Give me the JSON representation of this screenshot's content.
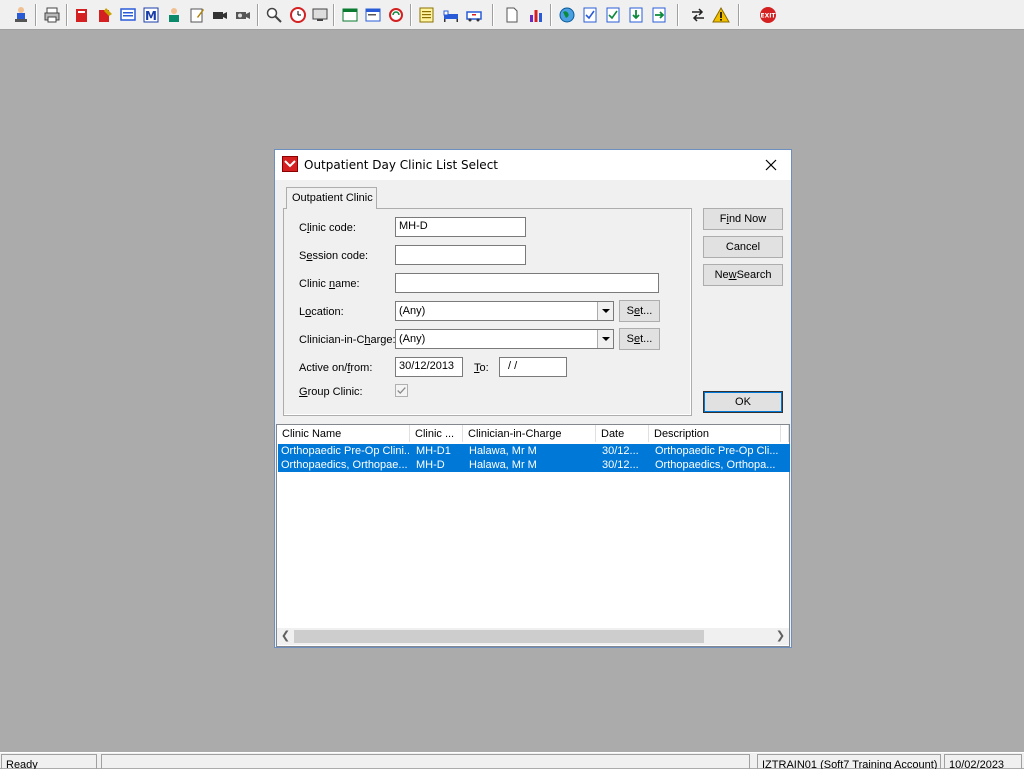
{
  "toolbar": {
    "buttons": [
      {
        "icon": "person-at-computer-icon",
        "color": "#2a5bd7"
      },
      {
        "icon": "printer-icon",
        "color": "#444444"
      },
      {
        "icon": "red-book-icon",
        "color": "#d42020"
      },
      {
        "icon": "book-edit-icon",
        "color": "#d42020"
      },
      {
        "icon": "screen-list-icon",
        "color": "#2a5bd7"
      },
      {
        "icon": "letter-m-icon",
        "color": "#1a3ea8"
      },
      {
        "icon": "doctor-icon",
        "color": "#0a8a6a"
      },
      {
        "icon": "notes-edit-icon",
        "color": "#b08000"
      },
      {
        "icon": "video-camera-icon",
        "color": "#333333"
      },
      {
        "icon": "video-camera-alt-icon",
        "color": "#333333"
      },
      {
        "icon": "magnify-icon",
        "color": "#444444"
      },
      {
        "icon": "clock-icon",
        "color": "#d42020"
      },
      {
        "icon": "monitor-icon",
        "color": "#444444"
      },
      {
        "icon": "window-panel-icon",
        "color": "#0a7a30"
      },
      {
        "icon": "window-list-icon",
        "color": "#2a5bd7"
      },
      {
        "icon": "globe-refresh-icon",
        "color": "#d42020"
      },
      {
        "icon": "yellow-notes-icon",
        "color": "#c8a000"
      },
      {
        "icon": "bed-icon",
        "color": "#2a5bd7"
      },
      {
        "icon": "ambulance-icon",
        "color": "#2a5bd7"
      },
      {
        "icon": "document-icon",
        "color": "#555555"
      },
      {
        "icon": "bar-chart-icon",
        "color": "#6a2ac0"
      },
      {
        "icon": "globe-icon",
        "color": "#0a8a3a"
      },
      {
        "icon": "form-check-icon",
        "color": "#2a5bd7"
      },
      {
        "icon": "form-tick-icon",
        "color": "#2a5bd7"
      },
      {
        "icon": "form-down-arrow-icon",
        "color": "#0a8a3a"
      },
      {
        "icon": "form-green-arrow-icon",
        "color": "#0a8a3a"
      },
      {
        "icon": "swap-arrows-icon",
        "color": "#222222"
      },
      {
        "icon": "warning-icon",
        "color": "#f0c000"
      },
      {
        "icon": "exit-icon",
        "color": "#d42020"
      }
    ]
  },
  "dialog": {
    "title": "Outpatient Day Clinic List Select",
    "tab_label": "Outpatient Clinic",
    "clinic_code_label_pre": "C",
    "clinic_code_label_ul": "l",
    "clinic_code_label_post": "inic code:",
    "clinic_code_value": "MH-D",
    "session_code_label_pre": "S",
    "session_code_label_ul": "e",
    "session_code_label_post": "ssion code:",
    "session_code_value": "",
    "clinic_name_label_pre": "Clinic ",
    "clinic_name_label_ul": "n",
    "clinic_name_label_post": "ame:",
    "clinic_name_value": "",
    "location_label_pre": "L",
    "location_label_ul": "o",
    "location_label_post": "cation:",
    "location_value": "(Any)",
    "clinician_label_pre": "Clinician-in-C",
    "clinician_label_ul": "h",
    "clinician_label_post": "arge:",
    "clinician_value": "(Any)",
    "set_pre": "S",
    "set_ul": "e",
    "set_post": "t...",
    "active_label_pre": "Active on/",
    "active_label_ul": "f",
    "active_label_post": "rom:",
    "active_from_value": "30/12/2013",
    "to_label_ul": "T",
    "to_label_post": "o:",
    "to_value": "/ /",
    "group_clinic_label_ul": "G",
    "group_clinic_label_post": "roup Clinic:",
    "group_clinic_checked": true,
    "find_now_pre": "F",
    "find_now_ul": "i",
    "find_now_post": "nd Now",
    "cancel_label": "Cancel",
    "new_search_pre": "Ne",
    "new_search_ul": "w",
    "new_search_post": " Search",
    "ok_label": "OK"
  },
  "list": {
    "columns": [
      "Clinic Name",
      "Clinic ...",
      "Clinician-in-Charge",
      "Date",
      "Description"
    ],
    "rows": [
      {
        "clinic_name": "Orthopaedic Pre-Op Clini...",
        "clinic_code": "MH-D1",
        "clinician": "Halawa, Mr M",
        "date": "30/12...",
        "description": "Orthopaedic Pre-Op Cli..."
      },
      {
        "clinic_name": "Orthopaedics, Orthopae...",
        "clinic_code": "MH-D",
        "clinician": "Halawa, Mr M",
        "date": "30/12...",
        "description": "Orthopaedics, Orthopa..."
      }
    ],
    "selection_color": "#0078d7"
  },
  "statusbar": {
    "status": "Ready",
    "account": "IZTRAIN01 (Soft7 Training Account)",
    "date": "10/02/2023"
  }
}
